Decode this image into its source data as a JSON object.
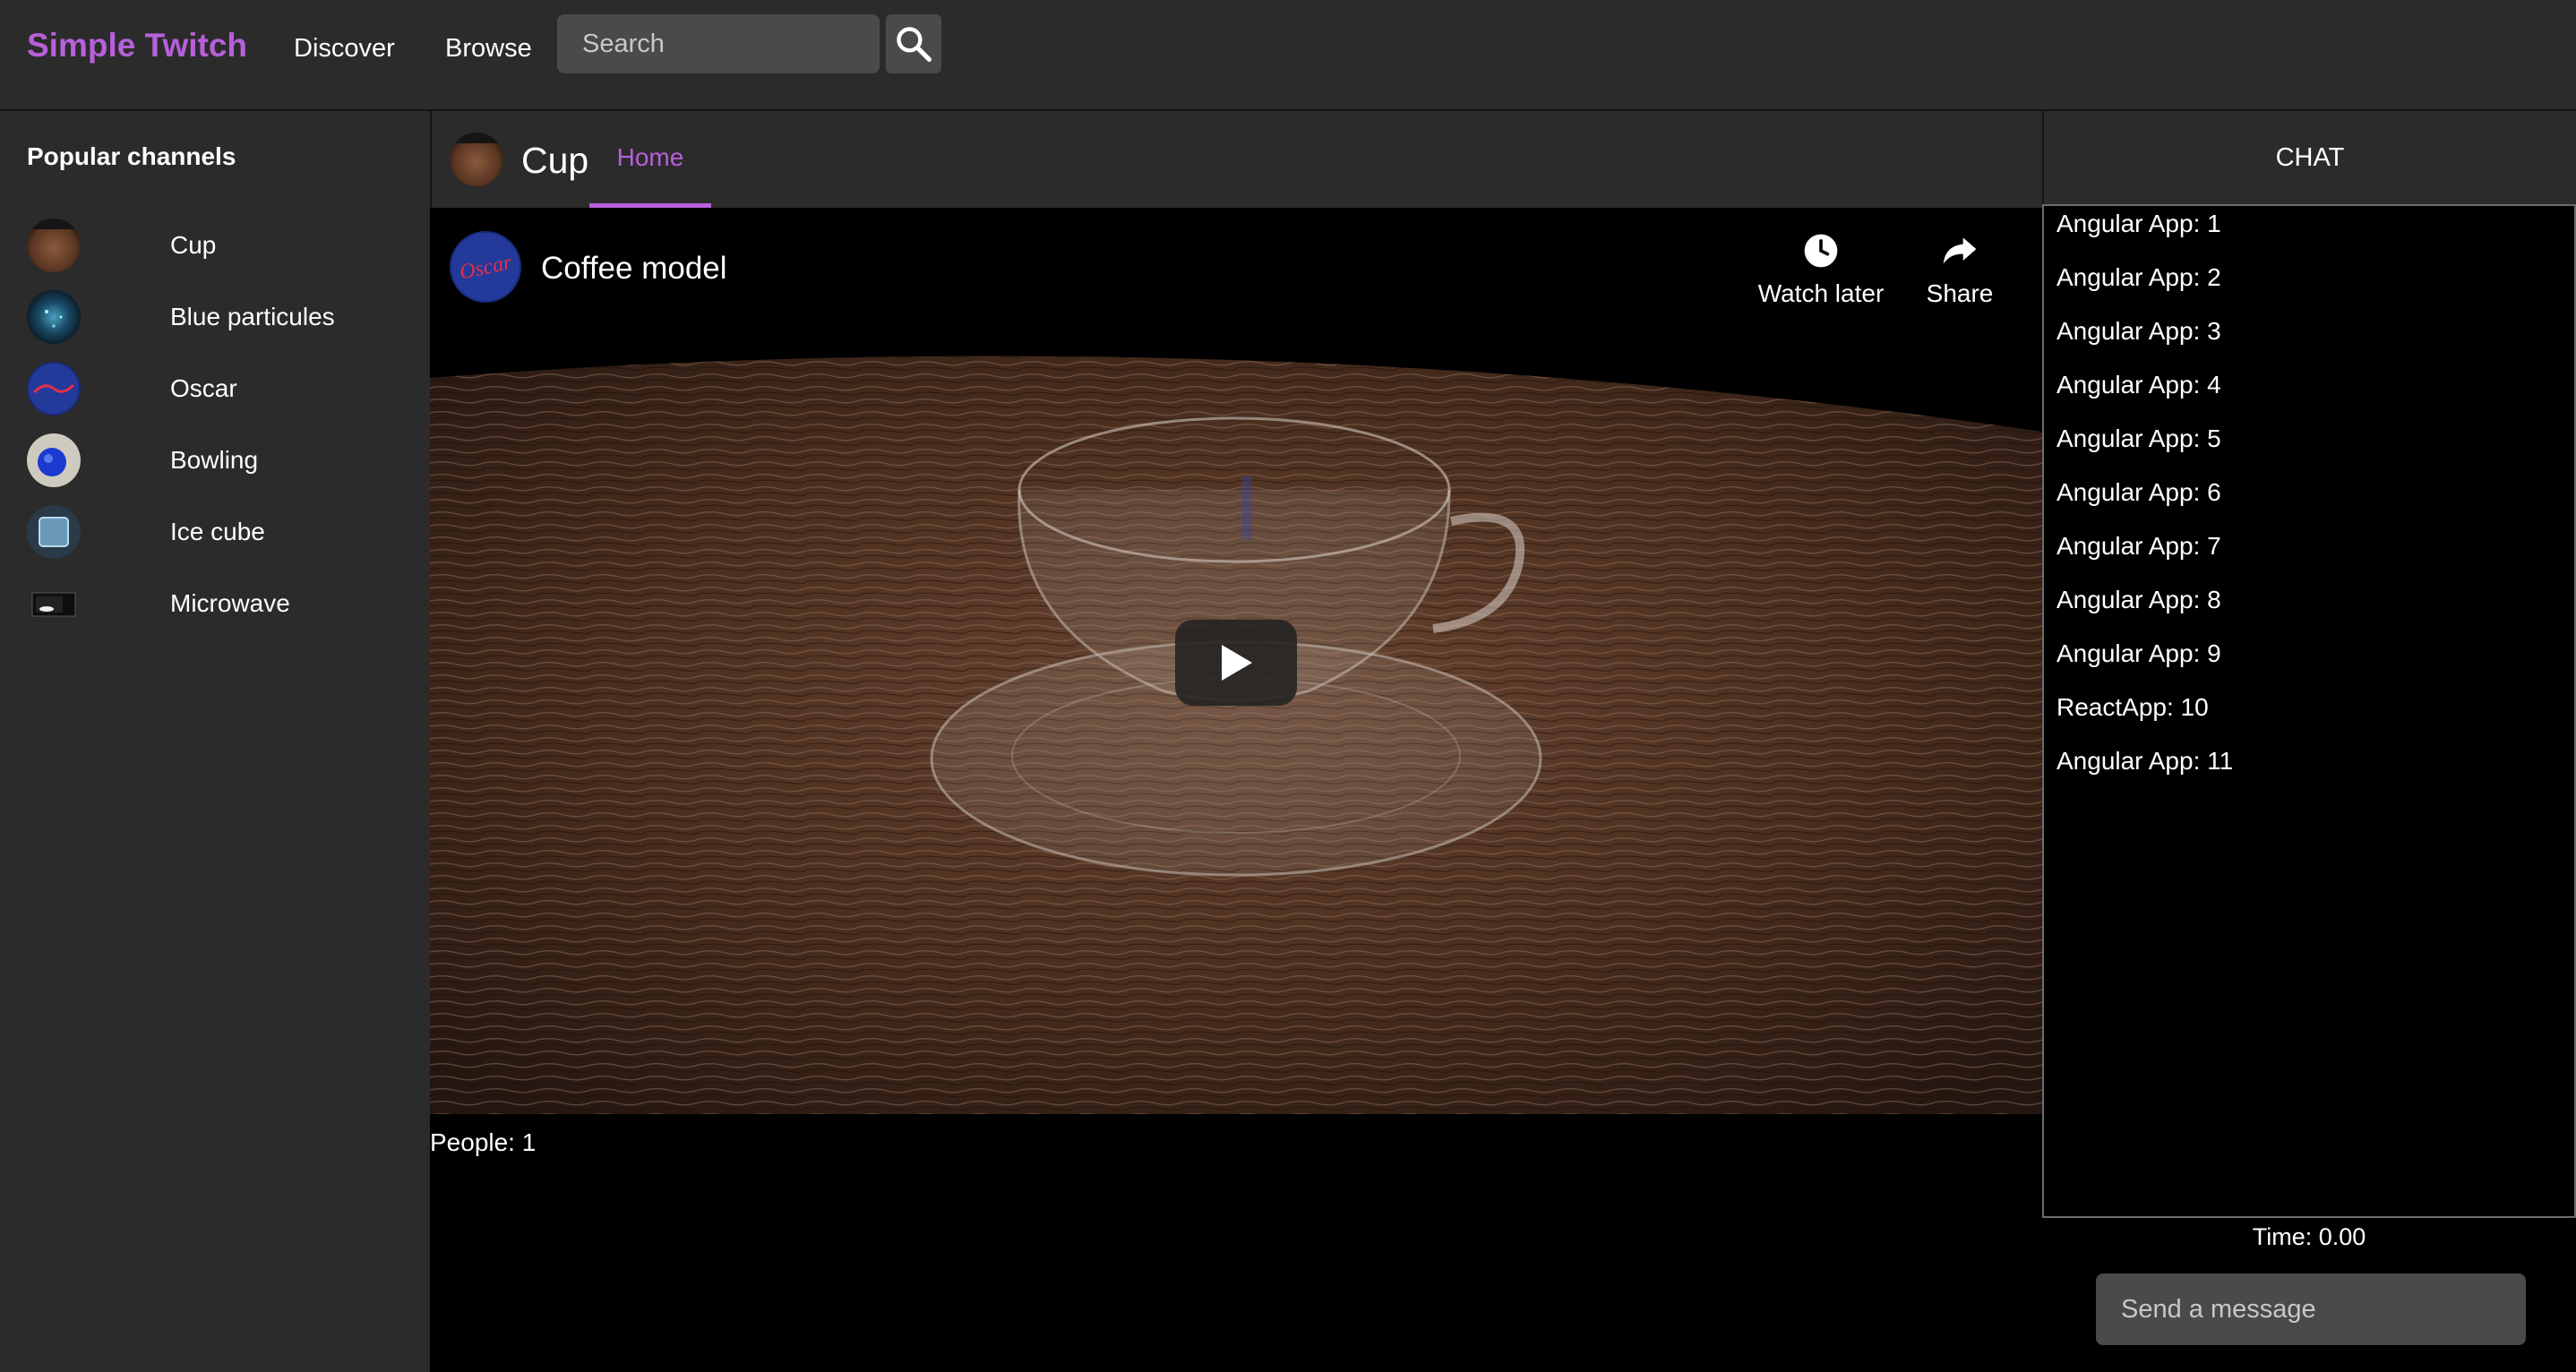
{
  "nav": {
    "brand": "Simple Twitch",
    "discover": "Discover",
    "browse": "Browse",
    "search_placeholder": "Search"
  },
  "sidebar": {
    "title": "Popular channels",
    "channels": [
      {
        "label": "Cup"
      },
      {
        "label": "Blue particules"
      },
      {
        "label": "Oscar"
      },
      {
        "label": "Bowling"
      },
      {
        "label": "Ice cube"
      },
      {
        "label": "Microwave"
      }
    ]
  },
  "channel": {
    "name": "Cup",
    "tab": "Home"
  },
  "video": {
    "title": "Coffee model",
    "channel_avatar_text": "Oscar",
    "watch_later": "Watch later",
    "share": "Share"
  },
  "people": "People: 1",
  "chat": {
    "header": "CHAT",
    "messages": [
      "Angular App:  1",
      "Angular App:  2",
      "Angular App:  3",
      "Angular App:  4",
      "Angular App:  5",
      "Angular App:  6",
      "Angular App:  7",
      "Angular App:  8",
      "Angular App:  9",
      "ReactApp:  10",
      "Angular App:  11"
    ],
    "time": "Time: 0.00",
    "input_placeholder": "Send a message"
  },
  "colors": {
    "accent": "#b760da",
    "panel": "#2b2b2b",
    "input": "#4a4a4a"
  }
}
